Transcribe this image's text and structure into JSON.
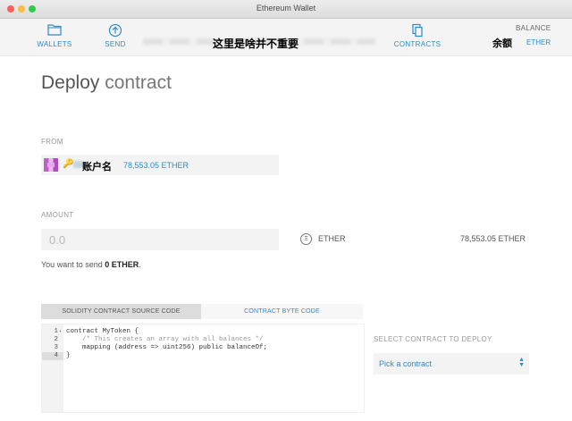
{
  "window": {
    "title": "Ethereum Wallet"
  },
  "nav": {
    "wallets_label": "WALLETS",
    "send_label": "SEND",
    "contracts_label": "CONTRACTS",
    "overlay_text": "这里是啥并不重要"
  },
  "balance": {
    "title": "BALANCE",
    "amount_overlay": "余额",
    "unit": "ETHER"
  },
  "page": {
    "title_strong": "Deploy",
    "title_light": "contract"
  },
  "from": {
    "label": "FROM",
    "account_name": "账户名",
    "account_balance": "78,553.05 ETHER"
  },
  "amount": {
    "label": "AMOUNT",
    "placeholder": "0.0",
    "unit": "ETHER",
    "total": "78,553.05 ETHER",
    "note_prefix": "You want to send",
    "note_value": "0 ETHER",
    "note_suffix": "."
  },
  "tabs": {
    "source": "SOLIDITY CONTRACT SOURCE CODE",
    "bytecode": "CONTRACT BYTE CODE"
  },
  "editor": {
    "line_numbers": [
      "1",
      "2",
      "3",
      "4"
    ],
    "lines": [
      "contract MyToken {",
      "    /* This creates an array with all balances */",
      "    mapping (address => uint256) public balanceOf;",
      "}"
    ]
  },
  "deploy": {
    "label": "SELECT CONTRACT TO DEPLOY",
    "selected": "Pick a contract"
  },
  "colors": {
    "accent": "#2e8bc4",
    "field_bg": "#f3f3f3"
  }
}
